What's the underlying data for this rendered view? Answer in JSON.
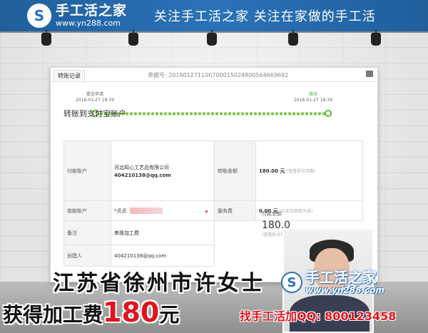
{
  "banner": {
    "logo_mark": "S",
    "logo_name": "手工活之家",
    "logo_url": "www.yn288.com",
    "slogan": "关注手工活之家  关注在家做的手工活"
  },
  "receipt": {
    "tab_label": "转账记录",
    "order_number": "单据号: 201801271100700015024800564669692",
    "steps": [
      {
        "label": "提交申请",
        "time": "2018-01-27 18:39"
      },
      {
        "label": "成功",
        "time": "2018-01-27 18:39"
      }
    ],
    "section_title": "转账到支付宝账户",
    "payer_label": "付款账户",
    "payer_name": "河北知心工艺品有限公司",
    "payer_account": "404210138@qq.com",
    "amount_label": "转账金额",
    "amount_value": "180.00 元",
    "amount_note": "(查看拆分页面)",
    "fee_label": "服务费",
    "fee_value": "0.00 元",
    "fee_note": "(以实际收取为准)",
    "payee_label": "收款账户",
    "payee_name": "*贞贞",
    "remark_label": "备注",
    "remark_value": "串珠加工费",
    "creator_label": "创建人",
    "creator_value": "404210138@qq.com",
    "total_label": "付款总额",
    "total_value": "180.0",
    "total_note": "(查看拆分页面)"
  },
  "captions": {
    "line1": "江苏省徐州市许女士",
    "line2_prefix": "获得加工费",
    "line2_amount": "180",
    "line2_suffix": "元",
    "watermark_name": "手工活之家",
    "watermark_url": "www.yn288.com",
    "contact": "找手工活加QQ: 800123458"
  },
  "colors": {
    "brand_blue": "#2b72b8",
    "success_green": "#5cb53a",
    "highlight_red": "#e0141e"
  }
}
